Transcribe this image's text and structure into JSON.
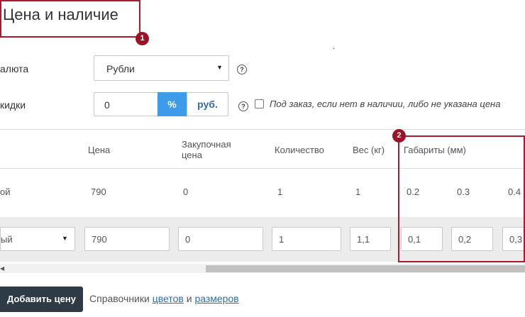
{
  "title": "Цена и наличие",
  "markers": [
    "1",
    "2"
  ],
  "stray_dot": ".",
  "currency": {
    "label": "алюта",
    "value": "Рубли"
  },
  "discount": {
    "label": "кидки",
    "value": "0",
    "pct_label": "%",
    "rub_label": "руб."
  },
  "help_glyph": "?",
  "preorder_text": "Под заказ, если нет в наличии, либо не указана цена",
  "table": {
    "headers": {
      "price": "Цена",
      "purchase_line1": "Закупочная",
      "purchase_line2": "цена",
      "quantity": "Количество",
      "weight": "Вес (кг)",
      "dims": "Габариты (мм)"
    },
    "row1": {
      "type": "ой",
      "price": "790",
      "purchase": "0",
      "quantity": "1",
      "weight": "1",
      "d1": "0.2",
      "d2": "0.3",
      "d3": "0.4"
    },
    "row2": {
      "type": "ый",
      "price": "790",
      "purchase": "0",
      "quantity": "1",
      "weight": "1,1",
      "d1": "0,1",
      "d2": "0,2",
      "d3": "0,3"
    }
  },
  "add_price_button": "Добавить цену",
  "references": {
    "prefix": "Справочники",
    "colors_link": "цветов",
    "and": "и",
    "sizes_link": "размеров"
  }
}
